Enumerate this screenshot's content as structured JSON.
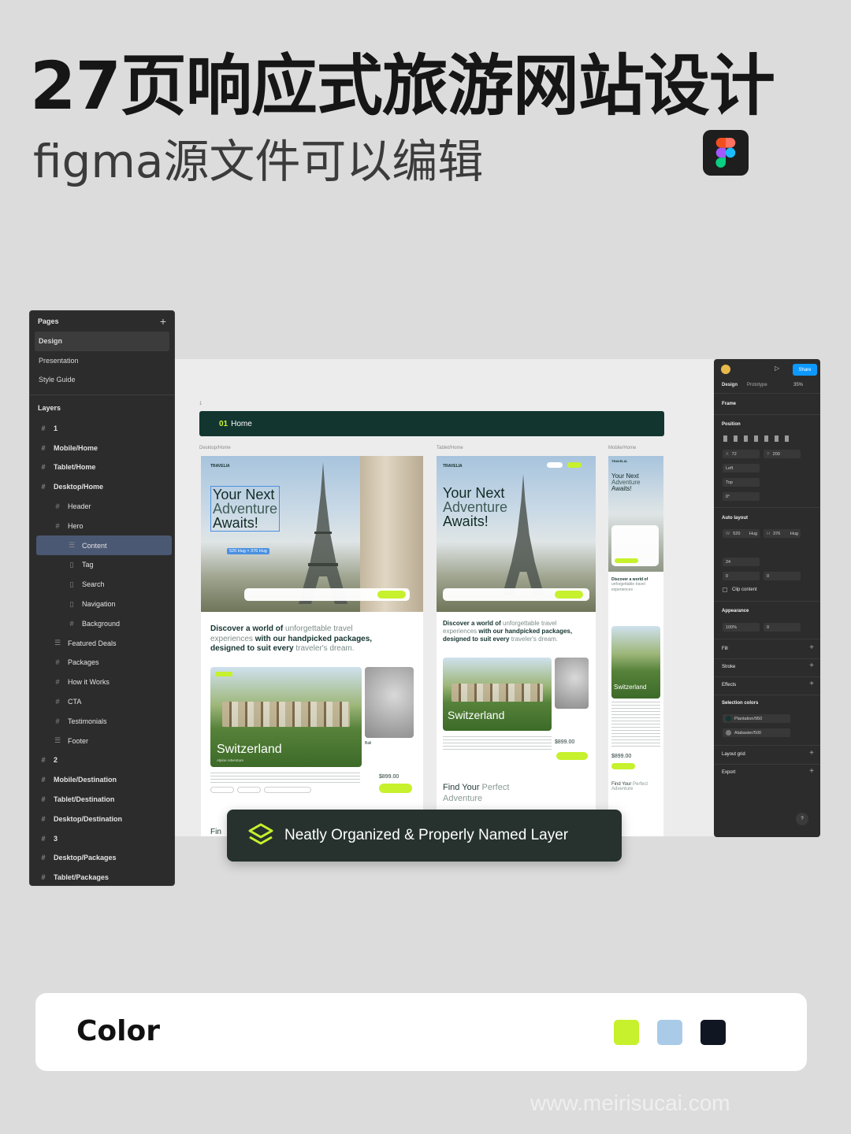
{
  "poster": {
    "headline": "27页响应式旅游网站设计",
    "subheadline": "figma源文件可以编辑"
  },
  "layers_panel": {
    "pages_title": "Pages",
    "pages": [
      "Design",
      "Presentation",
      "Style Guide"
    ],
    "layers_title": "Layers",
    "layers": [
      {
        "label": "1",
        "icon": "hash-icon",
        "indent": 0,
        "bold": true
      },
      {
        "label": "Mobile/Home",
        "icon": "frame-icon",
        "indent": 0,
        "bold": true
      },
      {
        "label": "Tablet/Home",
        "icon": "frame-icon",
        "indent": 0,
        "bold": true
      },
      {
        "label": "Desktop/Home",
        "icon": "frame-icon",
        "indent": 0,
        "bold": true
      },
      {
        "label": "Header",
        "icon": "frame-icon",
        "indent": 1,
        "bold": false
      },
      {
        "label": "Hero",
        "icon": "frame-icon",
        "indent": 1,
        "bold": false
      },
      {
        "label": "Content",
        "icon": "auto-layout-icon",
        "indent": 2,
        "bold": false,
        "selected": true
      },
      {
        "label": "Tag",
        "icon": "component-icon",
        "indent": 2,
        "bold": false
      },
      {
        "label": "Search",
        "icon": "component-icon",
        "indent": 2,
        "bold": false
      },
      {
        "label": "Navigation",
        "icon": "component-icon",
        "indent": 2,
        "bold": false
      },
      {
        "label": "Background",
        "icon": "frame-icon",
        "indent": 2,
        "bold": false
      },
      {
        "label": "Featured Deals",
        "icon": "auto-layout-icon",
        "indent": 1,
        "bold": false
      },
      {
        "label": "Packages",
        "icon": "frame-icon",
        "indent": 1,
        "bold": false
      },
      {
        "label": "How it Works",
        "icon": "frame-icon",
        "indent": 1,
        "bold": false
      },
      {
        "label": "CTA",
        "icon": "frame-icon",
        "indent": 1,
        "bold": false
      },
      {
        "label": "Testimonials",
        "icon": "frame-icon",
        "indent": 1,
        "bold": false
      },
      {
        "label": "Footer",
        "icon": "auto-layout-icon",
        "indent": 1,
        "bold": false
      },
      {
        "label": "2",
        "icon": "hash-icon",
        "indent": 0,
        "bold": true
      },
      {
        "label": "Mobile/Destination",
        "icon": "frame-icon",
        "indent": 0,
        "bold": true
      },
      {
        "label": "Tablet/Destination",
        "icon": "frame-icon",
        "indent": 0,
        "bold": true
      },
      {
        "label": "Desktop/Destination",
        "icon": "frame-icon",
        "indent": 0,
        "bold": true
      },
      {
        "label": "3",
        "icon": "hash-icon",
        "indent": 0,
        "bold": true
      },
      {
        "label": "Desktop/Packages",
        "icon": "frame-icon",
        "indent": 0,
        "bold": true
      },
      {
        "label": "Tablet/Packages",
        "icon": "frame-icon",
        "indent": 0,
        "bold": true
      }
    ]
  },
  "canvas": {
    "section_number": "1",
    "home_bar_number": "01",
    "home_bar_label": "Home",
    "frames": {
      "desktop_label": "Desktop/Home",
      "tablet_label": "Tablet/Home",
      "mobile_label": "Mobile/Home"
    },
    "logo": "TRAVELIA",
    "hero_lines": [
      "Your Next",
      "Adventure",
      "Awaits!"
    ],
    "selection_size": "520 Hug × 376 Hug",
    "promo": {
      "part1": "Discover a world of",
      "part2": "unforgettable travel experiences",
      "part3": "with our handpicked packages, designed to suit every",
      "part4": "traveler's dream."
    },
    "card_title": "Switzerland",
    "card_sub": "Alpine Adventure",
    "side_title": "Bali",
    "price": "$899.00",
    "find_heading_bold": "Find Your",
    "find_heading_light": "Perfect Adventure",
    "find_short": "Fin"
  },
  "properties_panel": {
    "share_label": "Share",
    "tab_design": "Design",
    "tab_prototype": "Prototype",
    "zoom": "35%",
    "frame_label": "Frame",
    "position_label": "Position",
    "x_value": "72",
    "y_value": "200",
    "align_h": "Left",
    "align_v": "Top",
    "rotation": "0°",
    "auto_layout_label": "Auto layout",
    "w_value": "520",
    "w_mode": "Hug",
    "h_value": "376",
    "h_mode": "Hug",
    "gap_value": "24",
    "pad_h": "0",
    "pad_v": "0",
    "clip_content": "Clip content",
    "appearance_label": "Appearance",
    "opacity": "100%",
    "radius": "0",
    "fill_label": "Fill",
    "stroke_label": "Stroke",
    "effects_label": "Effects",
    "selection_colors_label": "Selection colors",
    "selection_colors": [
      {
        "name": "Plantation/950",
        "color": "#123530"
      },
      {
        "name": "Alabaster/500",
        "color": "#7a7a7a"
      }
    ],
    "layout_grid_label": "Layout grid",
    "export_label": "Export",
    "help": "?"
  },
  "banner": {
    "text": "Neatly Organized & Properly Named Layer"
  },
  "color_card": {
    "title": "Color",
    "swatches": [
      "#c6f12c",
      "#a9cbe8",
      "#101722"
    ]
  },
  "watermark": "www.meirisucai.com",
  "colors": {
    "accent_lime": "#c6f12c",
    "dark_green": "#123530",
    "figma_blue": "#0d99ff"
  }
}
